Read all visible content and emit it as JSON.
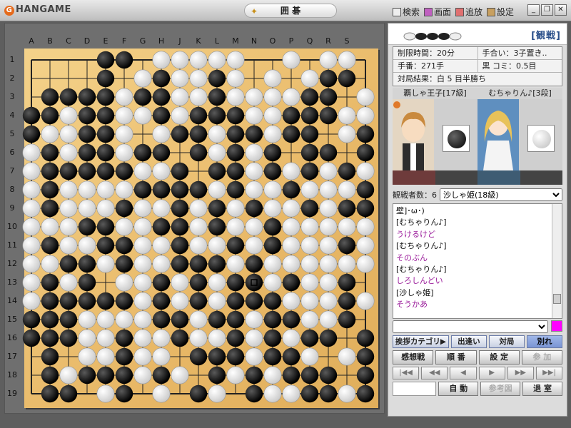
{
  "window": {
    "logo_text": "HANGAME",
    "title": "囲 碁",
    "menu": [
      {
        "label": "検索",
        "icon": "binoculars-icon"
      },
      {
        "label": "画面",
        "icon": "screen-icon"
      },
      {
        "label": "追放",
        "icon": "kick-icon"
      },
      {
        "label": "設定",
        "icon": "wrench-icon"
      }
    ],
    "controls": [
      "_",
      "❐",
      "✕"
    ]
  },
  "board": {
    "columns": [
      "A",
      "B",
      "C",
      "D",
      "E",
      "F",
      "G",
      "H",
      "J",
      "K",
      "L",
      "M",
      "N",
      "O",
      "P",
      "Q",
      "R",
      "S"
    ],
    "rows": [
      "1",
      "2",
      "3",
      "4",
      "5",
      "6",
      "7",
      "8",
      "9",
      "10",
      "11",
      "12",
      "13",
      "14",
      "15",
      "16",
      "17",
      "18",
      "19"
    ],
    "size": 19,
    "rows_state": [
      "....BB.WWWWW..W.WW.",
      "....B.WBWWBW.W.WBB.",
      ".BBBBWBBWWBWWWWBB.W",
      "BBWBBWWBWBBBWWBBBWW",
      "BWWBBW.WBBWBBWBB.WB",
      "WBWBBWBB.BWBWB.BB.B",
      "WBBBBBWWB.BBWBWBWBW",
      "WBWWWWBBBBWBWWBWWWB",
      "WBWWWBWWBWBWBWWBWBB",
      "WWWBBWWBBWBWWBWWWWW",
      "WBWWBBWWBWWBWBWWWBW",
      "WWBBWBWWBBBWBWWWWWW",
      "WBWB.WWBWBWBBWBWWB.",
      "WBBBBBWBWBWBBBWWWBW",
      "BBBWWWWBBWBBWBBWWB.",
      "BBBWWBWWBWWBWBWBB.B",
      ".B.WWBWW.BBBWBBW.WB",
      ".BWBBBWBW.BWBWBBB.B",
      ".BB.WB.W.BW.BWWBBWB"
    ],
    "last_move": "N13"
  },
  "side": {
    "watch_label": "[観戦]",
    "info": {
      "time_limit": "制限時間：20分",
      "handicap": "手合い：3子置き..",
      "moves": "手番：271手",
      "komi": "黒 コミ：0.5目",
      "result": "対局結果：白 5 目半勝ち"
    },
    "players": {
      "black": "覇しゃ王子[17級]",
      "white": "むちゃりん♪[3段]"
    },
    "viewers_label": "観戦者数：6",
    "viewer_selected": "沙しゃ姫(18級)",
    "chat": [
      {
        "kind": "sys",
        "text": "壁]･ω･)"
      },
      {
        "kind": "sys",
        "text": "[むちゃりん♪]"
      },
      {
        "kind": "msg",
        "text": "うけるけど"
      },
      {
        "kind": "sys",
        "text": "[むちゃりん♪]"
      },
      {
        "kind": "msg",
        "text": "そのぶん"
      },
      {
        "kind": "sys",
        "text": "[むちゃりん♪]"
      },
      {
        "kind": "msg",
        "text": "しろしんどい"
      },
      {
        "kind": "sys",
        "text": "[沙しゃ姫]"
      },
      {
        "kind": "msg",
        "text": "そうかあ"
      }
    ],
    "tab_buttons": [
      "挨拶カテゴリ▶",
      "出逢い",
      "対局",
      "別れ"
    ],
    "game_buttons": [
      "感想戦",
      "順 番",
      "設 定",
      "参 加"
    ],
    "nav_buttons": [
      "|◀◀",
      "◀◀",
      "◀",
      "▶",
      "▶▶",
      "▶▶|"
    ],
    "bottom_buttons": [
      "自 動",
      "参考図",
      "退 室"
    ],
    "colors": {
      "chat_msg": "#9a1b9a",
      "accent": "#ff00ff"
    }
  }
}
